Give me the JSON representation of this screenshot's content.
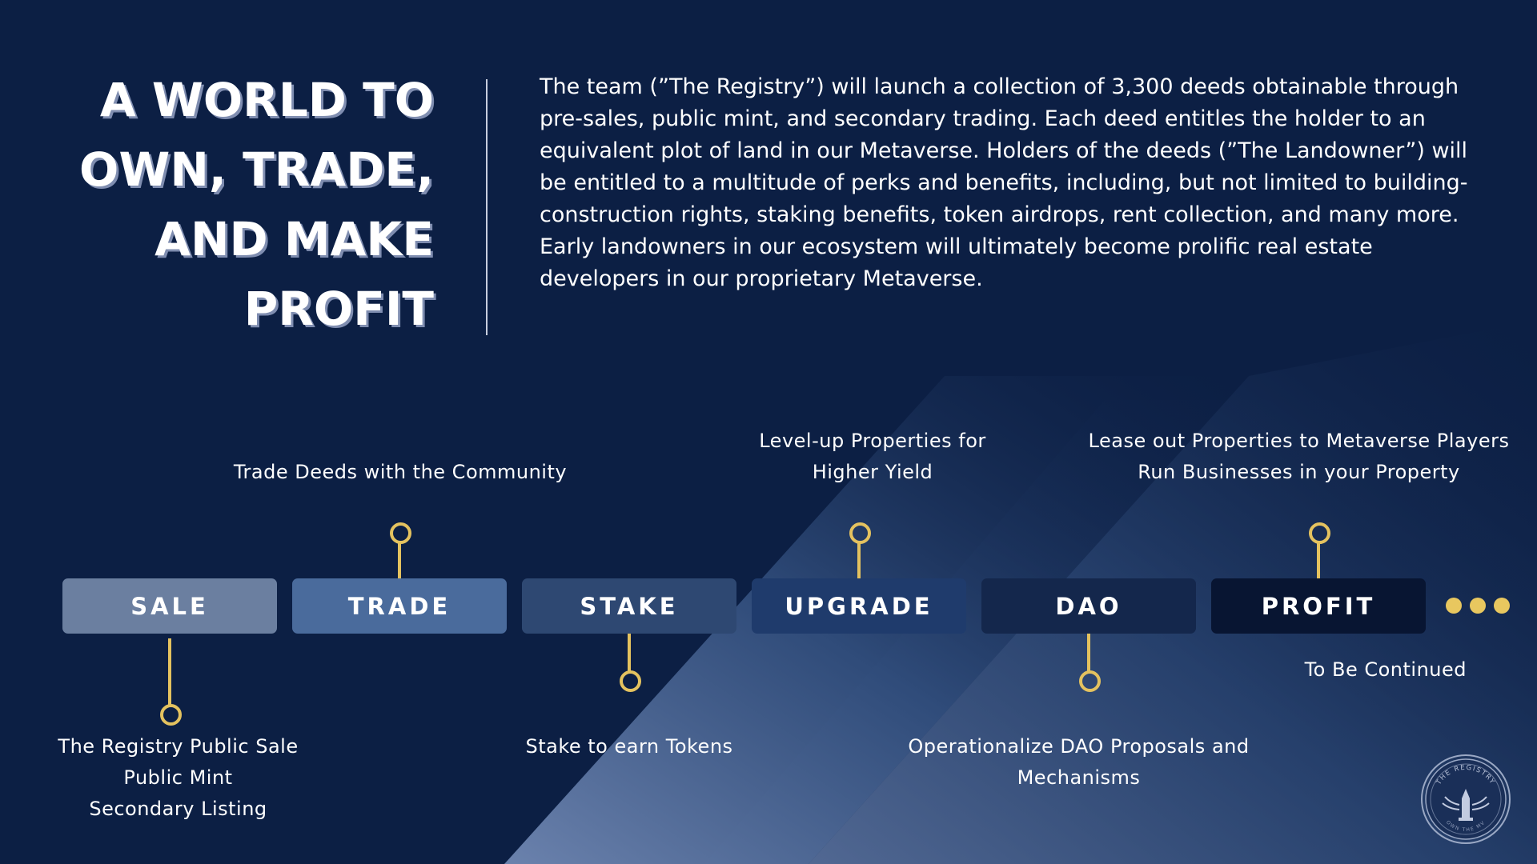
{
  "headline": {
    "lines": [
      "A WORLD TO",
      "OWN, TRADE,",
      "AND MAKE",
      "PROFIT"
    ]
  },
  "intro": {
    "text": "The team (”The Registry”) will launch a collection of 3,300 deeds obtainable through pre-sales, public mint, and secondary trading. Each deed entitles the holder to an equivalent plot of land in our Metaverse. Holders of the deeds (”The Landowner”) will be entitled to a multitude of perks and benefits, including, but not limited to building-construction rights, staking benefits, token airdrops, rent collection, and many more. Early landowners in our ecosystem will ultimately become prolific real estate developers in our proprietary Metaverse."
  },
  "steps": [
    {
      "label": "SALE",
      "color": "#6b7fa0"
    },
    {
      "label": "TRADE",
      "color": "#4a6b9c"
    },
    {
      "label": "STAKE",
      "color": "#2e4872"
    },
    {
      "label": "UPGRADE",
      "color": "#1f3b6c"
    },
    {
      "label": "DAO",
      "color": "#14274c"
    },
    {
      "label": "PROFIT",
      "color": "#081532"
    }
  ],
  "captions": {
    "sale": [
      "The Registry Public Sale",
      "Public Mint",
      "Secondary Listing"
    ],
    "trade": [
      "Trade Deeds with the Community"
    ],
    "stake": [
      "Stake to earn Tokens"
    ],
    "upgrade": [
      "Level-up Properties for",
      "Higher Yield"
    ],
    "dao": [
      "Operationalize DAO Proposals and",
      "Mechanisms"
    ],
    "profit": [
      "Lease out Properties to Metaverse Players",
      "Run Businesses in your Property"
    ],
    "continued": "To Be Continued"
  },
  "seal": {
    "top_text": "THE REGISTRY",
    "bottom_text": "OWN THE MV"
  },
  "colors": {
    "background": "#0c1f44",
    "accent_gold": "#e4c25f",
    "light_band": "#6f86b0"
  }
}
